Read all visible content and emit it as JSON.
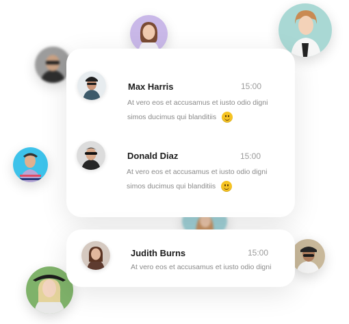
{
  "messages": [
    {
      "name": "Max Harris",
      "time": "15:00",
      "text_line1": "At vero eos et accusamus et iusto odio digni",
      "text_line2": "simos ducimus qui blanditiis",
      "emoji_icon": "smiley-emoji-icon"
    },
    {
      "name": "Donald Diaz",
      "time": "15:00",
      "text_line1": "At vero eos et accusamus et iusto odio digni",
      "text_line2": "simos ducimus qui blanditiis",
      "emoji_icon": "smiley-emoji-icon"
    },
    {
      "name": "Judith Burns",
      "time": "15:00",
      "text_line1": "At vero eos et accusamus et iusto odio digni"
    }
  ],
  "colors": {
    "card_bg": "#ffffff",
    "name_text": "#1b1b1b",
    "time_text": "#9a9a9a",
    "body_text": "#8a8a8a",
    "emoji": "#f6c323"
  }
}
